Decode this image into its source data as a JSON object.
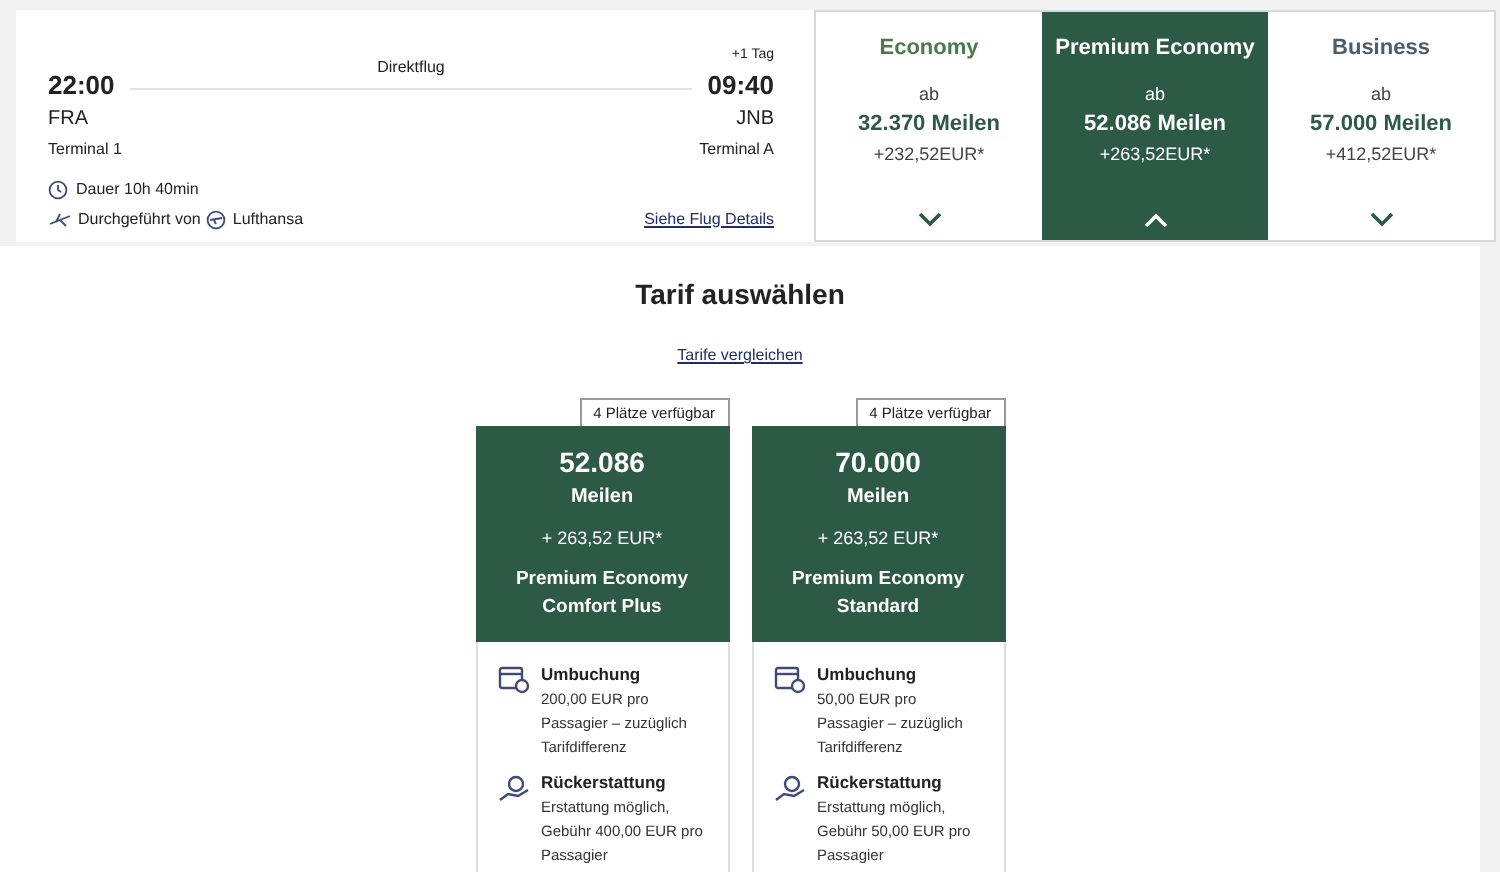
{
  "flight": {
    "departure_time": "22:00",
    "departure_airport": "FRA",
    "departure_terminal": "Terminal 1",
    "flight_type": "Direktflug",
    "day_offset": "+1 Tag",
    "arrival_time": "09:40",
    "arrival_airport": "JNB",
    "arrival_terminal": "Terminal A",
    "duration": "Dauer 10h 40min",
    "operated_by_label": "Durchgeführt von",
    "airline": "Lufthansa",
    "details_link": "Siehe Flug Details"
  },
  "cabins": [
    {
      "name": "Economy",
      "from": "ab",
      "miles": "32.370 Meilen",
      "surcharge": "+232,52EUR*",
      "selected": false,
      "color": "#4a7a47"
    },
    {
      "name": "Premium Economy",
      "from": "ab",
      "miles": "52.086 Meilen",
      "surcharge": "+263,52EUR*",
      "selected": true,
      "color": "#2d5a45"
    },
    {
      "name": "Business",
      "from": "ab",
      "miles": "57.000 Meilen",
      "surcharge": "+412,52EUR*",
      "selected": false,
      "color": "#4b5d6b"
    }
  ],
  "fare_section": {
    "title": "Tarif auswählen",
    "compare_link": "Tarife vergleichen"
  },
  "fares": [
    {
      "availability": "4 Plätze verfügbar",
      "miles": "52.086",
      "miles_unit": "Meilen",
      "surcharge": "+ 263,52 EUR*",
      "name": "Premium Economy Comfort Plus",
      "features": [
        {
          "kind": "rebooking",
          "title": "Umbuchung",
          "text": "200,00 EUR pro Passagier – zuzüglich Tarifdifferenz"
        },
        {
          "kind": "refund",
          "title": "Rückerstattung",
          "text": "Erstattung möglich, Gebühr 400,00 EUR pro Passagier"
        }
      ]
    },
    {
      "availability": "4 Plätze verfügbar",
      "miles": "70.000",
      "miles_unit": "Meilen",
      "surcharge": "+ 263,52 EUR*",
      "name": "Premium Economy Standard",
      "features": [
        {
          "kind": "rebooking",
          "title": "Umbuchung",
          "text": "50,00 EUR pro Passagier – zuzüglich Tarifdifferenz"
        },
        {
          "kind": "refund",
          "title": "Rückerstattung",
          "text": "Erstattung möglich, Gebühr 50,00 EUR pro Passagier"
        }
      ]
    }
  ]
}
